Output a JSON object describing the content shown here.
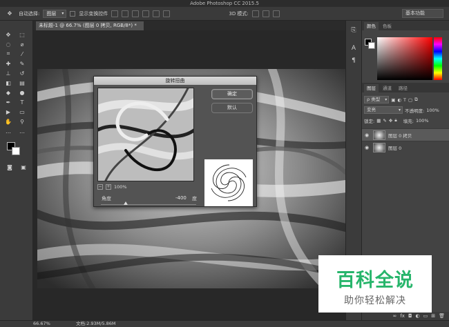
{
  "window": {
    "title": "Adobe Photoshop CC 2015.5"
  },
  "options_bar": {
    "auto_select_label": "自动选择:",
    "auto_select_value": "图层",
    "show_transform_label": "显示变换控件",
    "mode_3d_label": "3D 模式:",
    "workspace": "基本功能"
  },
  "document": {
    "tab_title": "未标题-1 @ 66.7% (图层 0 拷贝, RGB/8*) *"
  },
  "status": {
    "zoom": "66.67%",
    "doc_info": "文档:2.93M/5.86M"
  },
  "dialog": {
    "title": "旋转扭曲",
    "ok_label": "确定",
    "cancel_label": "默认",
    "zoom": "100%",
    "angle_label": "角度",
    "angle_value": "-400",
    "angle_unit": "度",
    "angle_slider_fraction": 0.26
  },
  "panels": {
    "color_tabs": [
      "颜色",
      "色板"
    ],
    "layer_tabs": [
      "图层",
      "通道",
      "路径"
    ],
    "filter_kind": "ρ 类型",
    "blend_mode": "变亮",
    "opacity_label": "不透明度:",
    "opacity_value": "100%",
    "lock_label": "锁定:",
    "fill_label": "填充:",
    "fill_value": "100%",
    "layers": [
      {
        "name": "图层 0 拷贝",
        "selected": true
      },
      {
        "name": "图层 0",
        "selected": false
      }
    ]
  },
  "watermark": {
    "main": "百科全说",
    "sub": "助你轻松解决"
  }
}
